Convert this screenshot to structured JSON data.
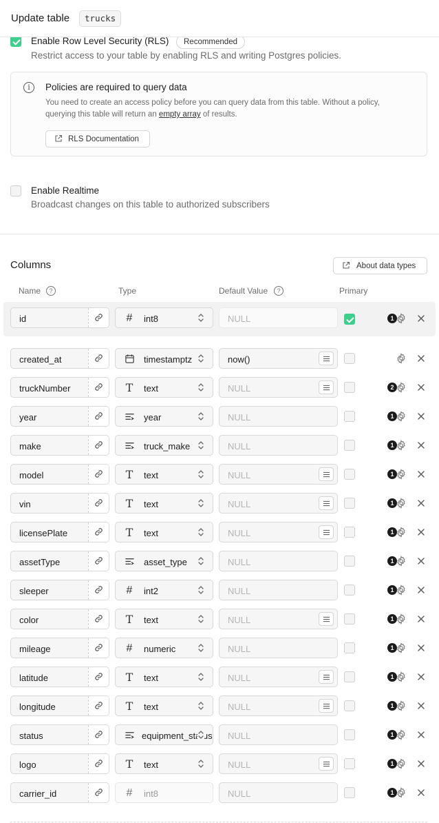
{
  "header": {
    "title": "Update table",
    "table_name": "trucks"
  },
  "rls": {
    "label": "Enable Row Level Security (RLS)",
    "badge": "Recommended",
    "description": "Restrict access to your table by enabling RLS and writing Postgres policies.",
    "checked": true
  },
  "info": {
    "title": "Policies are required to query data",
    "text_part1": "You need to create an access policy before you can query data from this table. Without a policy, querying this table will return an ",
    "text_link": "empty array",
    "text_part2": " of results.",
    "button": "RLS Documentation"
  },
  "realtime": {
    "label": "Enable Realtime",
    "description": "Broadcast changes on this table to authorized subscribers",
    "checked": false
  },
  "columns_section": {
    "title": "Columns",
    "about_button": "About data types",
    "headers": {
      "name": "Name",
      "type": "Type",
      "default": "Default Value",
      "primary": "Primary"
    }
  },
  "columns": [
    {
      "name": "id",
      "type": "int8",
      "type_icon": "hash-icon",
      "default": "NULL",
      "default_placeholder": true,
      "list_button": false,
      "primary": true,
      "badge": "1",
      "default_disabled": true
    },
    {
      "name": "created_at",
      "type": "timestamptz",
      "type_icon": "calendar-icon",
      "default": "now()",
      "default_placeholder": false,
      "list_button": true,
      "primary": false,
      "badge": ""
    },
    {
      "name": "truckNumber",
      "type": "text",
      "type_icon": "text-icon",
      "default": "NULL",
      "default_placeholder": true,
      "list_button": true,
      "primary": false,
      "badge": "2"
    },
    {
      "name": "year",
      "type": "year",
      "type_icon": "enum-icon",
      "default": "NULL",
      "default_placeholder": true,
      "list_button": false,
      "primary": false,
      "badge": "1"
    },
    {
      "name": "make",
      "type": "truck_make",
      "type_icon": "enum-icon",
      "default": "NULL",
      "default_placeholder": true,
      "list_button": false,
      "primary": false,
      "badge": "1"
    },
    {
      "name": "model",
      "type": "text",
      "type_icon": "text-icon",
      "default": "NULL",
      "default_placeholder": true,
      "list_button": true,
      "primary": false,
      "badge": "1"
    },
    {
      "name": "vin",
      "type": "text",
      "type_icon": "text-icon",
      "default": "NULL",
      "default_placeholder": true,
      "list_button": true,
      "primary": false,
      "badge": "1"
    },
    {
      "name": "licensePlate",
      "type": "text",
      "type_icon": "text-icon",
      "default": "NULL",
      "default_placeholder": true,
      "list_button": true,
      "primary": false,
      "badge": "1"
    },
    {
      "name": "assetType",
      "type": "asset_type",
      "type_icon": "enum-icon",
      "default": "NULL",
      "default_placeholder": true,
      "list_button": false,
      "primary": false,
      "badge": "1"
    },
    {
      "name": "sleeper",
      "type": "int2",
      "type_icon": "hash-icon",
      "default": "NULL",
      "default_placeholder": true,
      "list_button": false,
      "primary": false,
      "badge": "1"
    },
    {
      "name": "color",
      "type": "text",
      "type_icon": "text-icon",
      "default": "NULL",
      "default_placeholder": true,
      "list_button": true,
      "primary": false,
      "badge": "1"
    },
    {
      "name": "mileage",
      "type": "numeric",
      "type_icon": "hash-icon",
      "default": "NULL",
      "default_placeholder": true,
      "list_button": false,
      "primary": false,
      "badge": "1"
    },
    {
      "name": "latitude",
      "type": "text",
      "type_icon": "text-icon",
      "default": "NULL",
      "default_placeholder": true,
      "list_button": true,
      "primary": false,
      "badge": "1"
    },
    {
      "name": "longitude",
      "type": "text",
      "type_icon": "text-icon",
      "default": "NULL",
      "default_placeholder": true,
      "list_button": true,
      "primary": false,
      "badge": "1"
    },
    {
      "name": "status",
      "type": "equipment_status",
      "type_icon": "enum-icon",
      "default": "NULL",
      "default_placeholder": true,
      "list_button": false,
      "primary": false,
      "badge": "1"
    },
    {
      "name": "logo",
      "type": "text",
      "type_icon": "text-icon",
      "default": "NULL",
      "default_placeholder": true,
      "list_button": true,
      "primary": false,
      "badge": "1"
    },
    {
      "name": "carrier_id",
      "type": "int8",
      "type_icon": "hash-icon",
      "default": "NULL",
      "default_placeholder": true,
      "list_button": false,
      "primary": false,
      "badge": "1",
      "type_disabled": true
    }
  ],
  "colors": {
    "accent": "#3ecf8e",
    "text": "#1c1c1c",
    "muted": "#6b6b6b"
  }
}
